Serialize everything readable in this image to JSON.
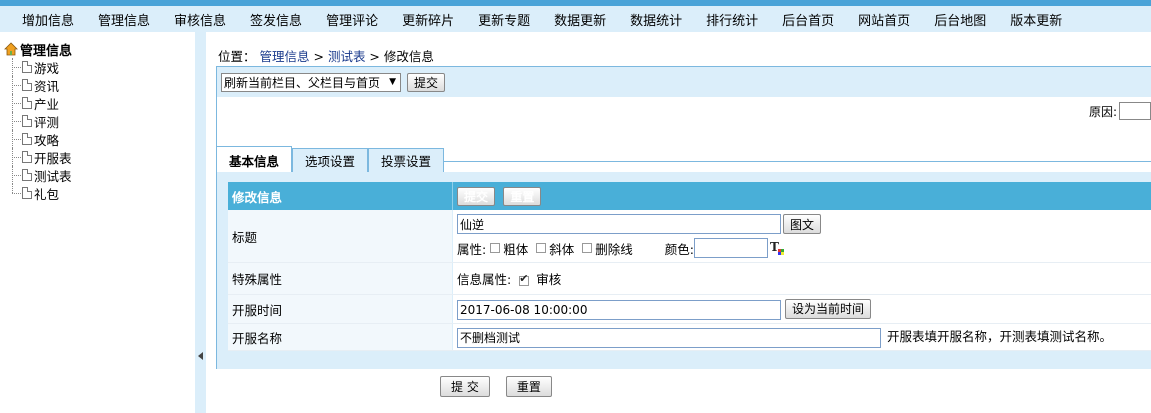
{
  "nav": [
    "增加信息",
    "管理信息",
    "审核信息",
    "签发信息",
    "管理评论",
    "更新碎片",
    "更新专题",
    "数据更新",
    "数据统计",
    "排行统计",
    "后台首页",
    "网站首页",
    "后台地图",
    "版本更新"
  ],
  "tree": {
    "root": "管理信息",
    "items": [
      "游戏",
      "资讯",
      "产业",
      "评测",
      "攻略",
      "开服表",
      "测试表",
      "礼包"
    ]
  },
  "breadcrumb": {
    "prefix": "位置：",
    "crumb1": "管理信息",
    "sep1": " > ",
    "crumb2": "测试表",
    "sep2": " > ",
    "current": "修改信息"
  },
  "refresh": {
    "selected": "刷新当前栏目、父栏目与首页",
    "submit": "提交"
  },
  "reason": {
    "label": "原因:"
  },
  "tabs": [
    "基本信息",
    "选项设置",
    "投票设置"
  ],
  "form": {
    "header_label": "修改信息",
    "header_submit": "提交",
    "header_reset": "重置",
    "title_label": "标题",
    "title_value": "仙逆",
    "title_btn": "图文",
    "attr_label": "属性:",
    "bold_label": "粗体",
    "italic_label": "斜体",
    "strike_label": "删除线",
    "color_label": "颜色:",
    "special_label": "特殊属性",
    "info_attr_label": "信息属性:",
    "review_label": "审核",
    "open_time_label": "开服时间",
    "open_time_value": "2017-06-08 10:00:00",
    "set_time_btn": "设为当前时间",
    "open_name_label": "开服名称",
    "open_name_value": "不删档测试",
    "open_name_hint": "开服表填开服名称，开测表填测试名称。"
  },
  "footer": {
    "submit": "提 交",
    "reset": "重置"
  }
}
